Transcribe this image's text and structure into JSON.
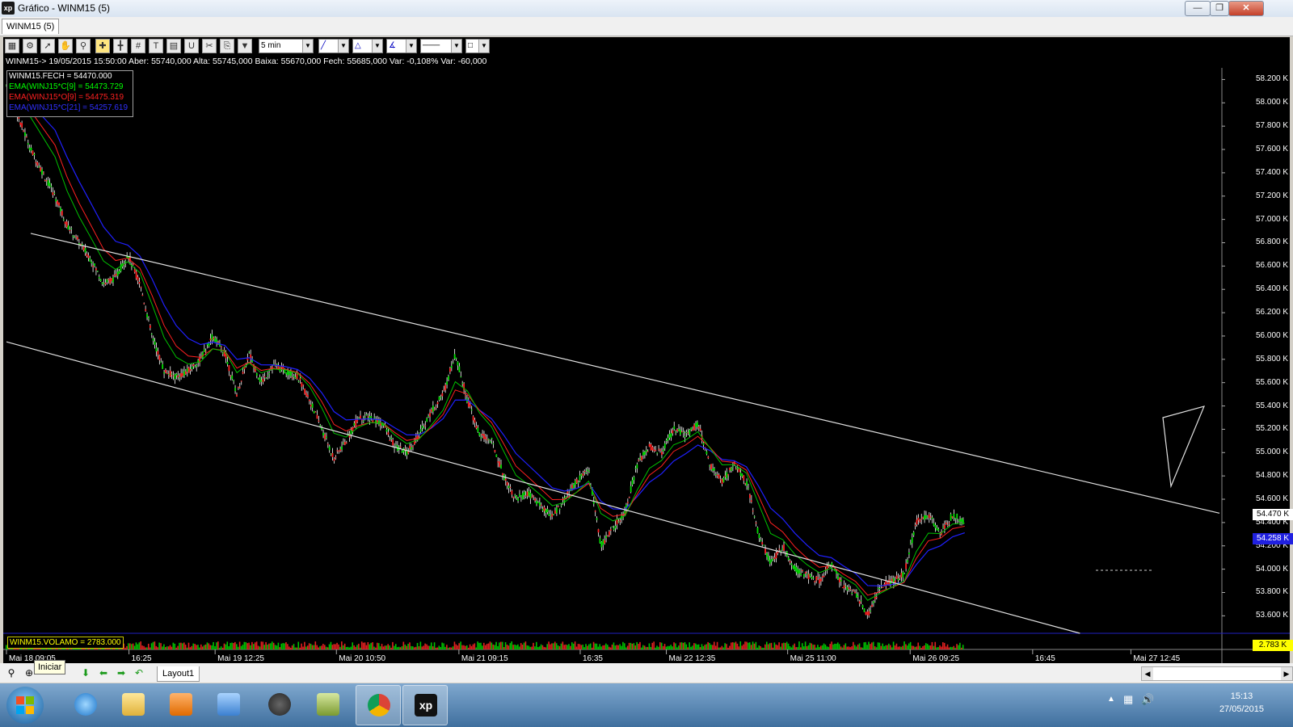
{
  "window": {
    "title": "Gráfico - WINM15 (5)",
    "logo": "xp",
    "minimize_icon": "minimize-icon",
    "maximize_icon": "restore-icon",
    "close_icon": "close-icon"
  },
  "doc_tab": {
    "label": "WINM15 (5)"
  },
  "toolbar": {
    "timeframe": "5 min",
    "icons": [
      "chart-icon",
      "gear-icon",
      "cursor-icon",
      "hand-icon",
      "zoom-icon",
      "crosshair-icon",
      "crosshair-alt-icon",
      "grid-icon",
      "text-icon",
      "calculator-icon",
      "magnet-icon",
      "eraser-icon",
      "clipboard-icon",
      "filter-icon"
    ]
  },
  "info_line": "WINM15-> 19/05/2015 15:50:00 Aber: 55740,000 Alta: 55745,000 Baixa: 55670,000 Fech: 55685,000 Var: -0,108% Var: -60,000",
  "legend": [
    {
      "text": "WINM15.FECH = 54470.000",
      "color": "#ffffff"
    },
    {
      "text": "EMA(WINJ15*C[9] = 54473.729",
      "color": "#00ff00"
    },
    {
      "text": "EMA(WINJ15*O[9] = 54475.319",
      "color": "#ff2020"
    },
    {
      "text": "EMA(WINJ15*C[21] = 54257.619",
      "color": "#3030ff"
    }
  ],
  "price_axis": {
    "ticks": [
      "58.200 K",
      "58.000 K",
      "57.800 K",
      "57.600 K",
      "57.400 K",
      "57.200 K",
      "57.000 K",
      "56.800 K",
      "56.600 K",
      "56.400 K",
      "56.200 K",
      "56.000 K",
      "55.800 K",
      "55.600 K",
      "55.400 K",
      "55.200 K",
      "55.000 K",
      "54.800 K",
      "54.600 K",
      "54.400 K",
      "54.200 K",
      "54.000 K",
      "53.800 K",
      "53.600 K"
    ],
    "current_price": "54.470 K",
    "ema_price": "54.258 K",
    "volume_value": "2.783 K"
  },
  "volume_label": "WINM15.VOLAMO = 2783.000",
  "time_axis": [
    "Mai 18 09:05",
    "16:25",
    "Mai 19 12:25",
    "Mai 20 10:50",
    "Mai 21 09:15",
    "16:35",
    "Mai 22 12:35",
    "Mai 25 11:00",
    "Mai 26 09:25",
    "16:45",
    "Mai 27 12:45"
  ],
  "chart_data": {
    "type": "line",
    "ylim": [
      53450,
      58300
    ],
    "x": [
      0,
      2,
      4,
      5,
      6,
      7,
      8,
      9,
      10,
      11,
      12,
      13,
      14,
      15,
      16,
      17,
      18,
      19,
      20,
      21,
      22,
      23,
      24,
      25,
      26,
      27,
      28,
      29,
      30,
      31,
      32,
      33,
      34,
      35,
      36,
      37,
      38,
      39,
      40,
      41,
      42,
      43,
      44,
      45,
      46,
      47,
      48,
      49,
      50,
      51,
      52,
      53,
      54,
      55,
      56,
      57,
      58,
      59,
      60,
      61,
      62,
      63,
      64,
      65,
      66,
      67,
      68,
      69,
      70,
      71,
      72,
      73,
      74,
      75,
      76,
      77,
      78,
      79,
      80,
      81,
      82,
      83,
      84,
      85,
      86,
      87,
      88,
      89,
      90,
      91,
      92,
      93,
      94,
      95,
      96,
      97,
      98,
      99,
      100
    ],
    "series": [
      {
        "name": "WINM15.FECH",
        "values": [
          58150,
          57600,
          57200,
          56950,
          56800,
          56650,
          56450,
          56500,
          56700,
          56450,
          56000,
          55700,
          55650,
          55700,
          55800,
          56000,
          55850,
          55500,
          55850,
          55600,
          55750,
          55700,
          55650,
          55450,
          55200,
          54950,
          55100,
          55300,
          55300,
          55250,
          55050,
          55000,
          55150,
          55350,
          55500,
          55850,
          55450,
          55150,
          55100,
          54800,
          54600,
          54650,
          54550,
          54450,
          54600,
          54750,
          54850,
          54200,
          54350,
          54500,
          54900,
          55050,
          55000,
          55200,
          55150,
          55250,
          54900,
          54750,
          54900,
          54750,
          54300,
          54050,
          54200,
          54000,
          53950,
          53900,
          54050,
          53850,
          53800,
          53600,
          53850,
          53900,
          53950,
          54400,
          54470,
          54300,
          54470,
          54400,
          54470,
          54470,
          54470,
          54470,
          54470,
          54470,
          54470,
          54470,
          54470,
          54470,
          54470,
          54470,
          54470,
          54470,
          54470,
          54470,
          54470,
          54470,
          54470,
          54470,
          54470
        ]
      }
    ],
    "title": "",
    "xlabel": "",
    "ylabel": "",
    "trend_lines": [
      {
        "from": [
          2,
          56880
        ],
        "to": [
          100,
          54480
        ]
      },
      {
        "from": [
          0,
          55950
        ],
        "to": [
          88.5,
          53450
        ]
      }
    ]
  },
  "bottom": {
    "start_tooltip": "Iniciar",
    "layout_tab": "Layout1"
  },
  "taskbar": {
    "time": "15:13",
    "date": "27/05/2015"
  }
}
